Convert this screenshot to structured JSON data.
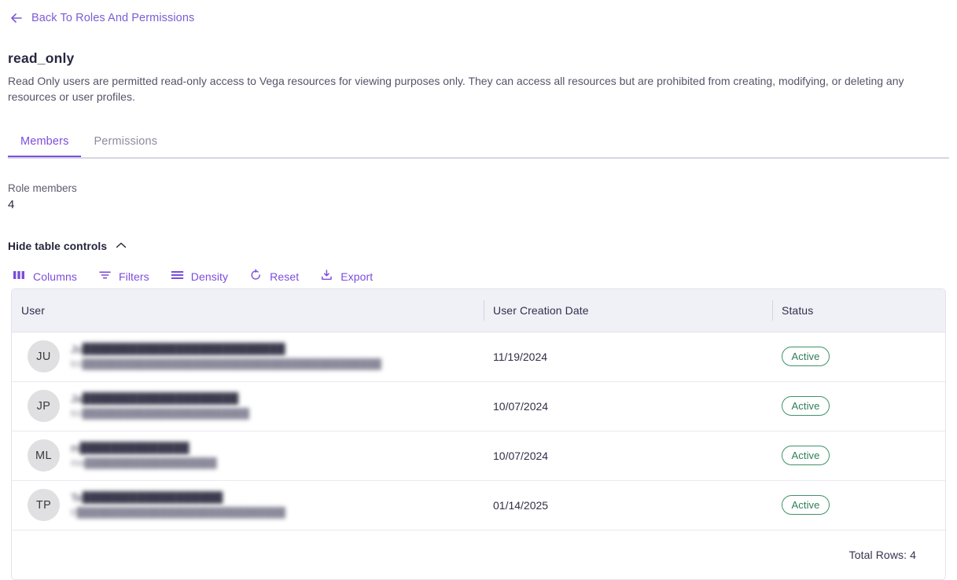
{
  "back_link": {
    "label": "Back To Roles And Permissions",
    "icon": "arrow-left-icon"
  },
  "header": {
    "title": "read_only",
    "description": "Read Only users are permitted read-only access to Vega resources for viewing purposes only. They can access all resources but are prohibited from creating, modifying, or deleting any resources or user profiles."
  },
  "tabs": [
    {
      "label": "Members",
      "active": true
    },
    {
      "label": "Permissions",
      "active": false
    }
  ],
  "summary": {
    "label": "Role members",
    "value": "4"
  },
  "table_controls": {
    "toggle_label": "Hide table controls",
    "toggle_icon": "chevron-up-icon",
    "buttons": [
      {
        "label": "Columns",
        "icon": "columns-icon"
      },
      {
        "label": "Filters",
        "icon": "filter-icon"
      },
      {
        "label": "Density",
        "icon": "density-icon"
      },
      {
        "label": "Reset",
        "icon": "reset-icon"
      },
      {
        "label": "Export",
        "icon": "download-icon"
      }
    ]
  },
  "table": {
    "columns": [
      "User",
      "User Creation Date",
      "Status"
    ],
    "rows": [
      {
        "initials": "JU",
        "name": "Jo██████████████████████████",
        "email": "tro███████████████████████████████████████████",
        "date": "11/19/2024",
        "status": "Active"
      },
      {
        "initials": "JP",
        "name": "Ja████████████████████",
        "email": "tro████████████████████████",
        "date": "10/07/2024",
        "status": "Active"
      },
      {
        "initials": "ML",
        "name": "m██████████████",
        "email": "ma███████████████████",
        "date": "10/07/2024",
        "status": "Active"
      },
      {
        "initials": "TP",
        "name": "Te██████████████████",
        "email": "tr██████████████████████████████",
        "date": "01/14/2025",
        "status": "Active"
      }
    ],
    "footer": {
      "total_rows_label": "Total Rows: 4"
    }
  },
  "colors": {
    "accent": "#7c4ddd",
    "link": "#7c5cd6",
    "header_bg": "#f0f1f6",
    "status_green": "#2f7d58",
    "text": "#2f2f46",
    "muted": "#8b8b9e"
  }
}
